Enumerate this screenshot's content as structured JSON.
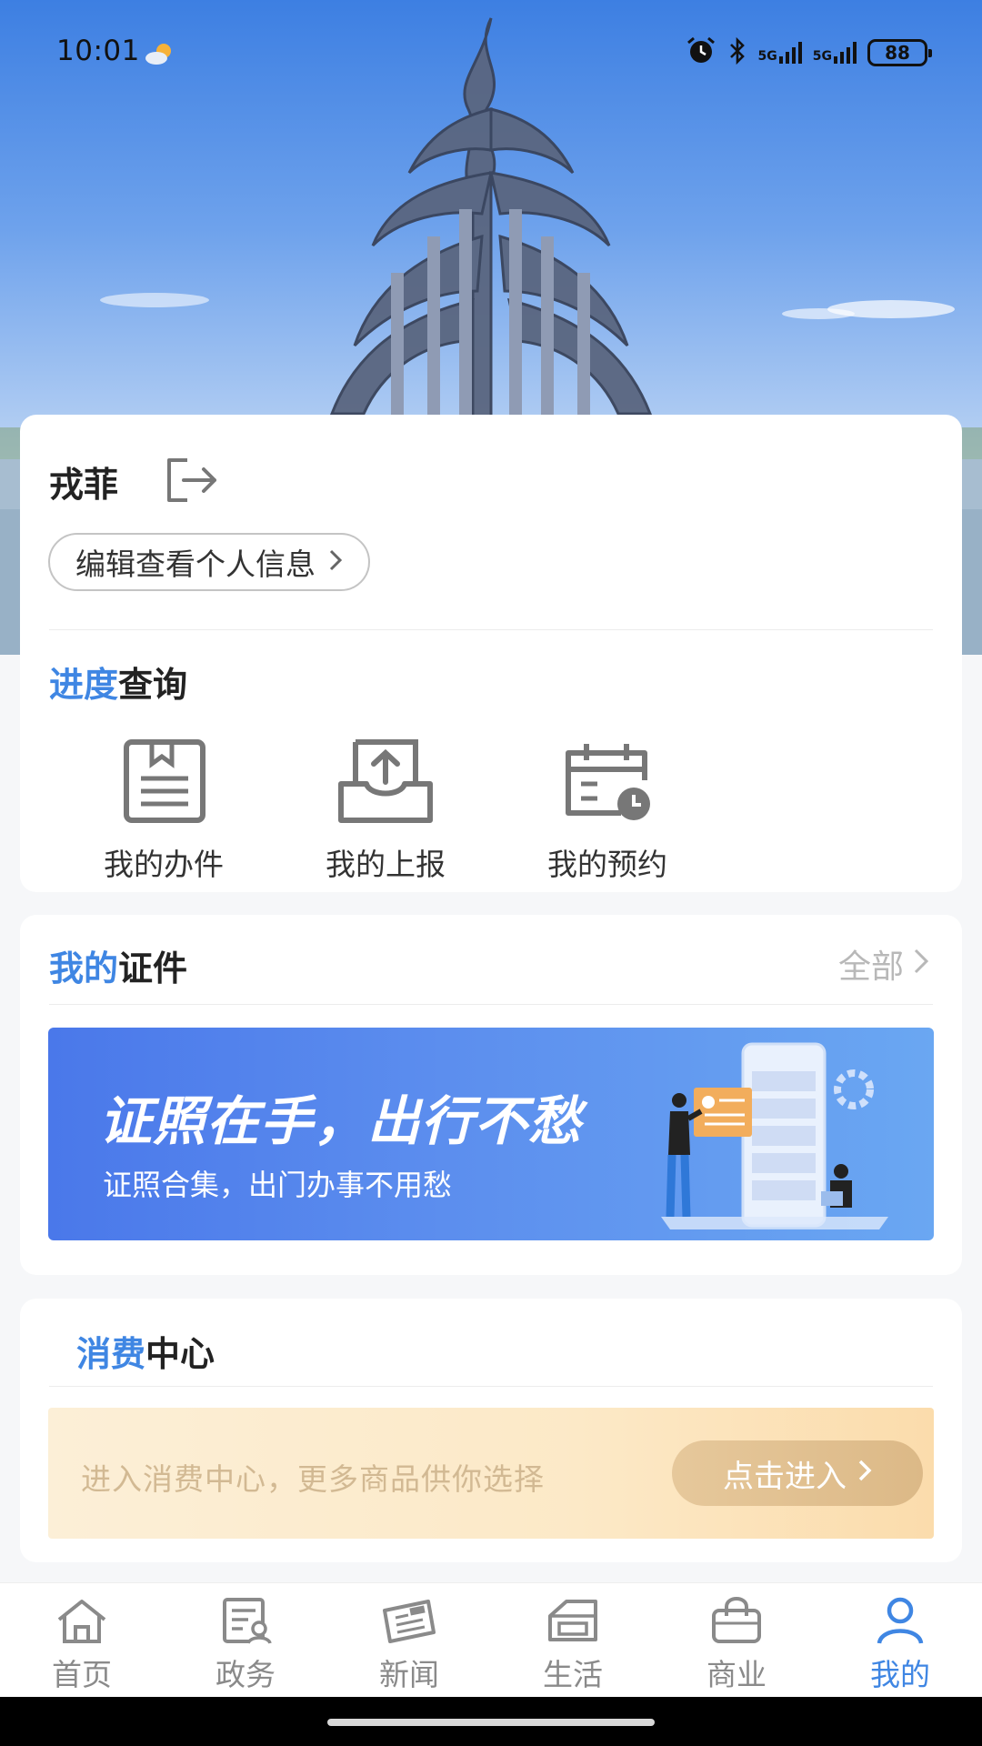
{
  "status_bar": {
    "time": "10:01",
    "weather_icon": "sun-cloud-icon",
    "network_1": "5G",
    "network_2": "5G",
    "battery": "88"
  },
  "profile": {
    "name": "戎菲",
    "edit_label": "编辑查看个人信息"
  },
  "progress": {
    "title_accent": "进度",
    "title_rest": "查询",
    "items": [
      {
        "label": "我的办件",
        "icon": "document-icon"
      },
      {
        "label": "我的上报",
        "icon": "upload-tray-icon"
      },
      {
        "label": "我的预约",
        "icon": "calendar-clock-icon"
      }
    ]
  },
  "certificates": {
    "title_accent": "我的",
    "title_rest": "证件",
    "see_all": "全部",
    "banner_title": "证照在手，出行不愁",
    "banner_subtitle": "证照合集，出门办事不用愁"
  },
  "consume": {
    "title_accent": "消费",
    "title_rest": "中心",
    "banner_text": "进入消费中心，更多商品供你选择",
    "button_label": "点击进入"
  },
  "bottom_nav": {
    "items": [
      {
        "label": "首页",
        "icon": "home-icon"
      },
      {
        "label": "政务",
        "icon": "government-affairs-icon"
      },
      {
        "label": "新闻",
        "icon": "newspaper-icon"
      },
      {
        "label": "生活",
        "icon": "life-icon"
      },
      {
        "label": "商业",
        "icon": "shopping-bag-icon"
      },
      {
        "label": "我的",
        "icon": "user-icon"
      }
    ],
    "active_index": 5
  },
  "colors": {
    "accent": "#3f86e3",
    "inactive": "#8a8a8a",
    "consume_button": "#dcb987"
  }
}
